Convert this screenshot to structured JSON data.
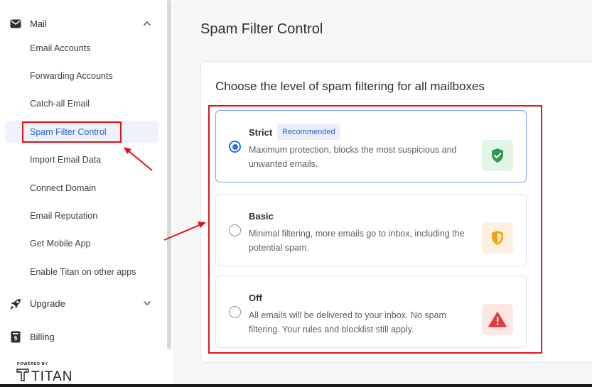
{
  "sidebar": {
    "mail_section": {
      "label": "Mail",
      "icon": "mail-icon"
    },
    "items": [
      {
        "label": "Email Accounts"
      },
      {
        "label": "Forwarding Accounts"
      },
      {
        "label": "Catch-all Email"
      },
      {
        "label": "Spam Filter Control",
        "active": true
      },
      {
        "label": "Import Email Data"
      },
      {
        "label": "Connect Domain"
      },
      {
        "label": "Email Reputation"
      },
      {
        "label": "Get Mobile App"
      },
      {
        "label": "Enable Titan on other apps"
      }
    ],
    "upgrade_section": {
      "label": "Upgrade",
      "icon": "rocket-icon"
    },
    "billing_section": {
      "label": "Billing",
      "icon": "billing-icon"
    },
    "powered_by": "POWERED BY",
    "brand": "TITAN"
  },
  "main": {
    "title": "Spam Filter Control",
    "card_heading": "Choose the level of spam filtering for all mailboxes",
    "selected_option": "Strict",
    "options": [
      {
        "title": "Strict",
        "badge": "Recommended",
        "description": "Maximum protection, blocks the most suspicious and unwanted emails.",
        "icon": "shield-check-icon",
        "status_color": "#2e9b4e",
        "status_bg": "#e3f5e6"
      },
      {
        "title": "Basic",
        "description": "Minimal filtering, more emails go to inbox, including the potential spam.",
        "icon": "shield-half-icon",
        "status_color": "#f0a30a",
        "status_bg": "#fdf0e0"
      },
      {
        "title": "Off",
        "description": "All emails will be delivered to your inbox. No spam filtering. Your rules and blocklist still apply.",
        "icon": "warning-triangle-icon",
        "status_color": "#e03b3b",
        "status_bg": "#fde6e6"
      }
    ]
  },
  "colors": {
    "accent": "#2f6fe4",
    "annotation": "#e0131b"
  }
}
